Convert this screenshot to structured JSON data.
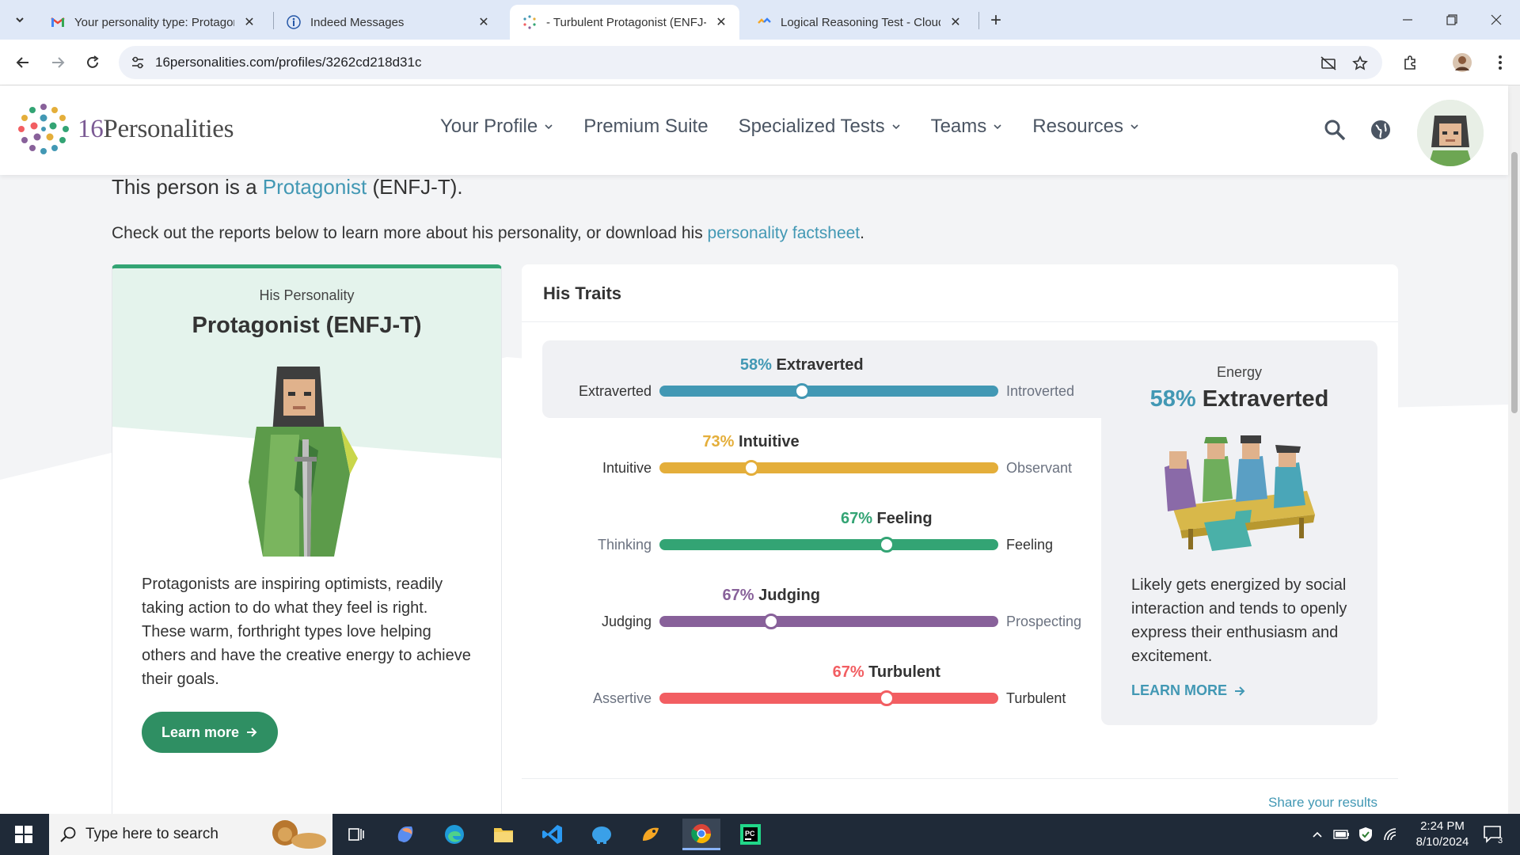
{
  "browser": {
    "tabs": [
      {
        "title": "Your personality type: Protagonist",
        "icon": "gmail-icon"
      },
      {
        "title": "Indeed Messages",
        "icon": "indeed-icon"
      },
      {
        "title": "- Turbulent Protagonist (ENFJ-T",
        "icon": "16personalities-icon",
        "active": true
      },
      {
        "title": "Logical Reasoning Test - Cloud",
        "icon": "cloud-icon"
      }
    ],
    "url": "16personalities.com/profiles/3262cd218d31c"
  },
  "site": {
    "logo_number": "16",
    "logo_word": "Personalities",
    "nav": [
      {
        "label": "Your Profile",
        "dropdown": true
      },
      {
        "label": "Premium Suite",
        "dropdown": false
      },
      {
        "label": "Specialized Tests",
        "dropdown": true
      },
      {
        "label": "Teams",
        "dropdown": true
      },
      {
        "label": "Resources",
        "dropdown": true
      }
    ]
  },
  "intro": {
    "person_prefix": "This person is a ",
    "type_link": "Protagonist",
    "type_code": " (ENFJ-T).",
    "check_text": "Check out the reports below to learn more about his personality, or download his ",
    "factsheet_link": "personality factsheet",
    "check_end": "."
  },
  "personality_card": {
    "label": "His Personality",
    "title": "Protagonist (ENFJ-T)",
    "description": "Protagonists are inspiring optimists, readily taking action to do what they feel is right. These warm, forthright types love helping others and have the creative energy to achieve their goals.",
    "button": "Learn more",
    "pager": {
      "pages": 3,
      "current": 1
    }
  },
  "traits": {
    "title": "His Traits",
    "items": [
      {
        "pct": "58%",
        "name": "Extraverted",
        "left": "Extraverted",
        "right": "Introverted",
        "position": 0.42,
        "color": "#4298b4",
        "dominant": "left"
      },
      {
        "pct": "73%",
        "name": "Intuitive",
        "left": "Intuitive",
        "right": "Observant",
        "position": 0.27,
        "color": "#e4ae3a",
        "dominant": "left"
      },
      {
        "pct": "67%",
        "name": "Feeling",
        "left": "Thinking",
        "right": "Feeling",
        "position": 0.67,
        "color": "#33a474",
        "dominant": "right"
      },
      {
        "pct": "67%",
        "name": "Judging",
        "left": "Judging",
        "right": "Prospecting",
        "position": 0.33,
        "color": "#88619a",
        "dominant": "left"
      },
      {
        "pct": "67%",
        "name": "Turbulent",
        "left": "Assertive",
        "right": "Turbulent",
        "position": 0.67,
        "color": "#f25e62",
        "dominant": "right"
      }
    ],
    "energy": {
      "label": "Energy",
      "pct": "58%",
      "name": "Extraverted",
      "description": "Likely gets energized by social interaction and tends to openly express their enthusiasm and excitement.",
      "link": "LEARN MORE"
    },
    "share": "Share your results"
  },
  "taskbar": {
    "search_placeholder": "Type here to search",
    "time": "2:24 PM",
    "date": "8/10/2024",
    "notifications": "3"
  }
}
